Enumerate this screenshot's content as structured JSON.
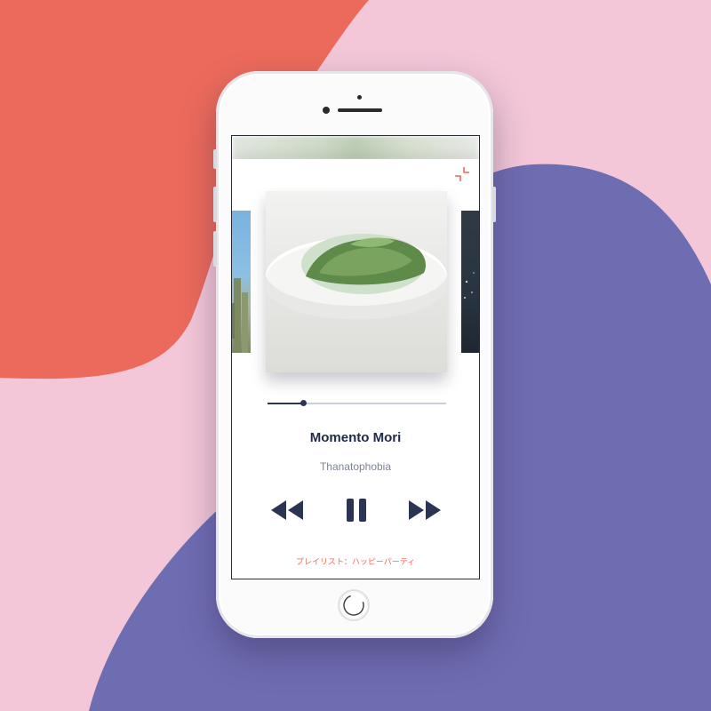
{
  "track": {
    "title": "Momento Mori",
    "artist": "Thanatophobia",
    "progress_fraction": 0.2
  },
  "playlist": {
    "label": "プレイリスト：ハッピーパーティ"
  },
  "icons": {
    "collapse": "collapse-icon",
    "rewind": "rewind-icon",
    "pause": "pause-icon",
    "fast_forward": "fast-forward-icon"
  },
  "colors": {
    "background_pink": "#f3c7d8",
    "blob_coral": "#ec6a5c",
    "blob_purple": "#6f6db2",
    "accent": "#ef6a5b",
    "title": "#1f2a4a",
    "controls": "#2b3452"
  }
}
